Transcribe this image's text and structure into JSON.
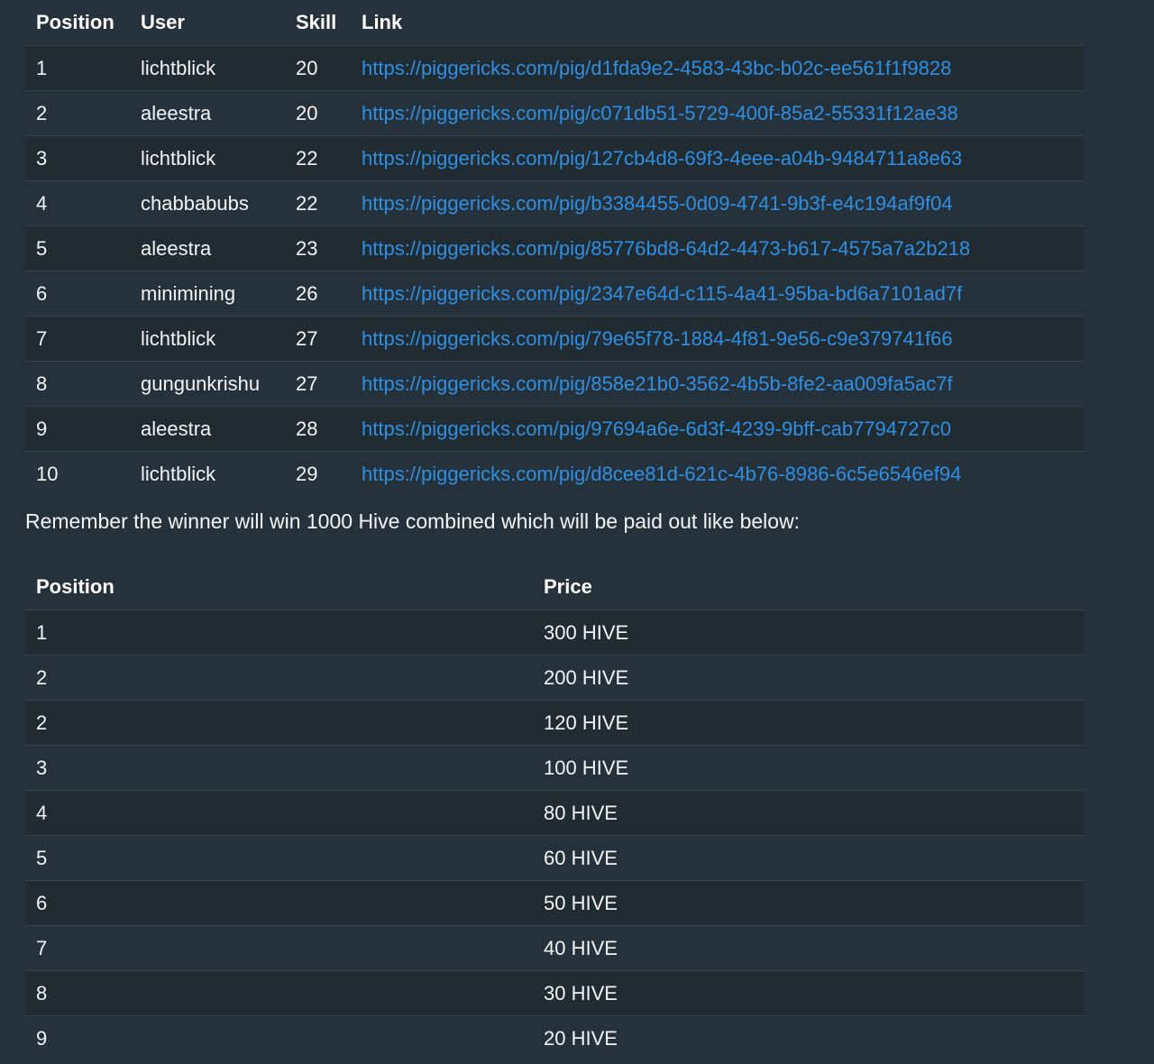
{
  "rank_table": {
    "headers": [
      "Position",
      "User",
      "Skill",
      "Link"
    ],
    "rows": [
      {
        "position": "1",
        "user": "lichtblick",
        "skill": "20",
        "link": "https://piggericks.com/pig/d1fda9e2-4583-43bc-b02c-ee561f1f9828"
      },
      {
        "position": "2",
        "user": "aleestra",
        "skill": "20",
        "link": "https://piggericks.com/pig/c071db51-5729-400f-85a2-55331f12ae38"
      },
      {
        "position": "3",
        "user": "lichtblick",
        "skill": "22",
        "link": "https://piggericks.com/pig/127cb4d8-69f3-4eee-a04b-9484711a8e63"
      },
      {
        "position": "4",
        "user": "chabbabubs",
        "skill": "22",
        "link": "https://piggericks.com/pig/b3384455-0d09-4741-9b3f-e4c194af9f04"
      },
      {
        "position": "5",
        "user": "aleestra",
        "skill": "23",
        "link": "https://piggericks.com/pig/85776bd8-64d2-4473-b617-4575a7a2b218"
      },
      {
        "position": "6",
        "user": "minimining",
        "skill": "26",
        "link": "https://piggericks.com/pig/2347e64d-c115-4a41-95ba-bd6a7101ad7f"
      },
      {
        "position": "7",
        "user": "lichtblick",
        "skill": "27",
        "link": "https://piggericks.com/pig/79e65f78-1884-4f81-9e56-c9e379741f66"
      },
      {
        "position": "8",
        "user": "gungunkrishu",
        "skill": "27",
        "link": "https://piggericks.com/pig/858e21b0-3562-4b5b-8fe2-aa009fa5ac7f"
      },
      {
        "position": "9",
        "user": "aleestra",
        "skill": "28",
        "link": "https://piggericks.com/pig/97694a6e-6d3f-4239-9bff-cab7794727c0"
      },
      {
        "position": "10",
        "user": "lichtblick",
        "skill": "29",
        "link": "https://piggericks.com/pig/d8cee81d-621c-4b76-8986-6c5e6546ef94"
      }
    ]
  },
  "prize_note": "Remember the winner will win 1000 Hive combined which will be paid out like below:",
  "prize_table": {
    "headers": [
      "Position",
      "Price"
    ],
    "rows": [
      {
        "position": "1",
        "price": "300 HIVE"
      },
      {
        "position": "2",
        "price": "200 HIVE"
      },
      {
        "position": "2",
        "price": "120 HIVE"
      },
      {
        "position": "3",
        "price": "100 HIVE"
      },
      {
        "position": "4",
        "price": "80 HIVE"
      },
      {
        "position": "5",
        "price": "60 HIVE"
      },
      {
        "position": "6",
        "price": "50 HIVE"
      },
      {
        "position": "7",
        "price": "40 HIVE"
      },
      {
        "position": "8",
        "price": "30 HIVE"
      },
      {
        "position": "9",
        "price": "20 HIVE"
      }
    ]
  },
  "colors": {
    "background": "#26323b",
    "row_alt": "#212b32",
    "link": "#2f8fe3",
    "text": "#f2f4f6"
  }
}
